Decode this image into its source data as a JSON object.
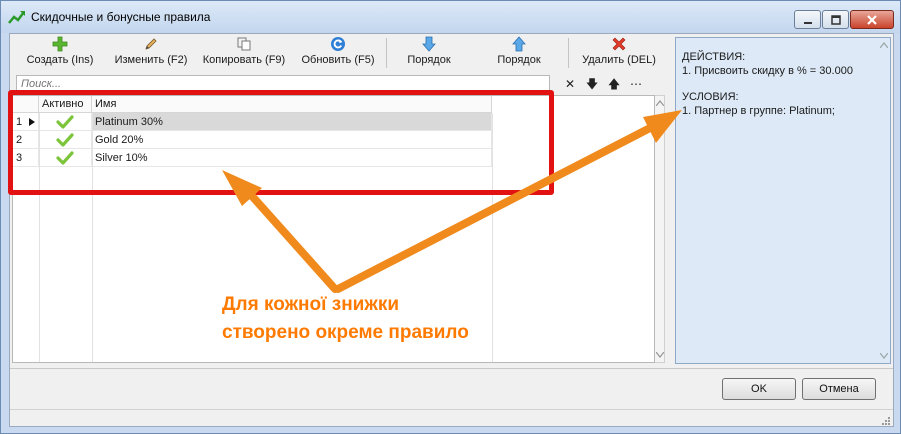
{
  "window": {
    "title": "Скидочные и бонусные правила",
    "accent": "#c9daf0"
  },
  "toolbar": {
    "create": "Создать (Ins)",
    "edit": "Изменить (F2)",
    "copy": "Копировать (F9)",
    "refresh": "Обновить (F5)",
    "order_down": "Порядок",
    "order_up": "Порядок",
    "delete": "Удалить (DEL)"
  },
  "search": {
    "placeholder": "Поиск...",
    "clear_icon": "✕",
    "down_icon": "🡇",
    "up_icon": "🡅",
    "more_icon": "⋯"
  },
  "grid": {
    "col_active": "Активно",
    "col_name": "Имя",
    "rows": [
      {
        "num": "1",
        "name": "Platinum 30%"
      },
      {
        "num": "2",
        "name": "Gold 20%"
      },
      {
        "num": "3",
        "name": "Silver 10%"
      }
    ]
  },
  "details": {
    "actions_header": "ДЕЙСТВИЯ:",
    "action_1": "1. Присвоить скидку в % = 30.000",
    "conditions_header": "УСЛОВИЯ:",
    "condition_1": "1. Партнер в группе: Platinum;"
  },
  "buttons": {
    "ok": "OK",
    "cancel": "Отмена"
  },
  "annotation": {
    "line1": "Для кожної знижки",
    "line2": "створено окреме правило",
    "color": "#ff7a00",
    "box_color": "#e31212"
  }
}
